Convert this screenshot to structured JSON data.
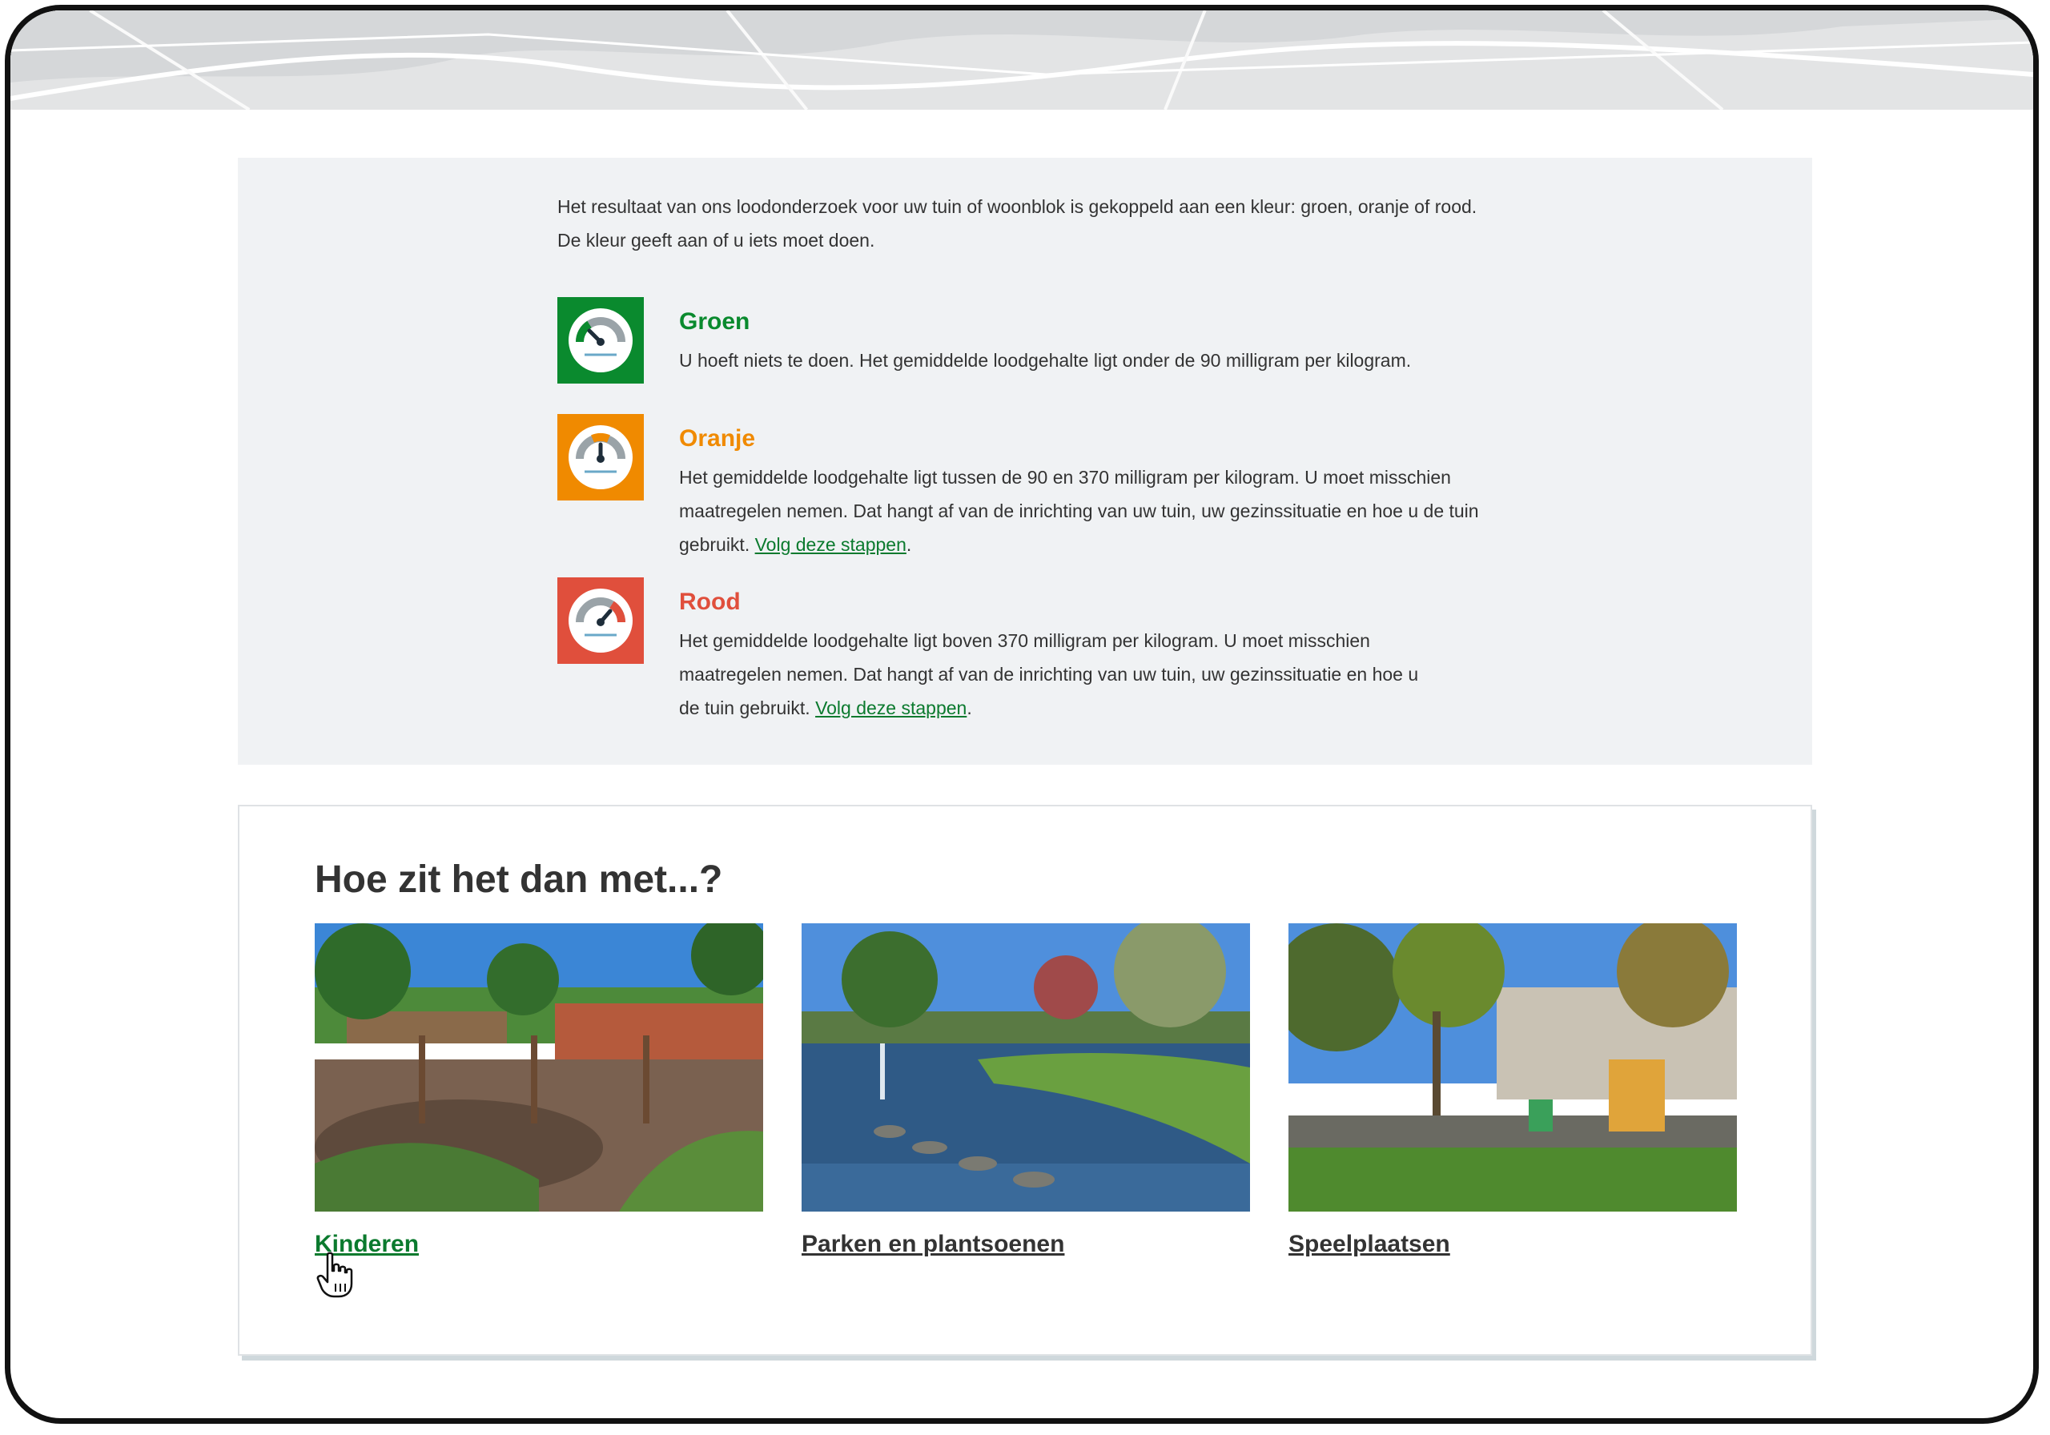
{
  "legend": {
    "intro": "Het resultaat van ons loodonderzoek voor uw tuin of woonblok is gekoppeld aan een kleur: groen, oranje of rood. De kleur geeft aan of u iets moet doen.",
    "items": [
      {
        "title": "Groen",
        "color": "#0a8a2e",
        "icon": "gauge-green-icon",
        "text": "U hoeft niets te doen. Het gemiddelde loodgehalte ligt onder de 90 milligram per kilogram."
      },
      {
        "title": "Oranje",
        "color": "#f08a00",
        "icon": "gauge-orange-icon",
        "text": "Het gemiddelde loodgehalte ligt tussen de 90 en 370 milligram per kilogram.  U moet misschien maatregelen nemen.  Dat hangt af van de inrichting van uw tuin, uw gezinssituatie en hoe u de tuin gebruikt. ",
        "link": "Volg deze stappen"
      },
      {
        "title": "Rood",
        "color": "#e04f3c",
        "icon": "gauge-red-icon",
        "text": "Het gemiddelde loodgehalte ligt boven 370 milligram per kilogram. U moet misschien maatregelen nemen.  Dat hangt af van de inrichting van uw tuin, uw gezinssituatie en hoe u de tuin gebruikt. ",
        "link": "Volg deze stappen"
      }
    ]
  },
  "related": {
    "title": "Hoe zit het dan met...?",
    "tiles": [
      {
        "label": "Kinderen",
        "photo": "playground-children-photo"
      },
      {
        "label": "Parken en plantsoenen",
        "photo": "park-pond-photo"
      },
      {
        "label": "Speelplaatsen",
        "photo": "playground-square-photo"
      }
    ]
  },
  "colors": {
    "link": "#0b7a2e",
    "panel": "#f0f2f4",
    "text": "#333333"
  }
}
